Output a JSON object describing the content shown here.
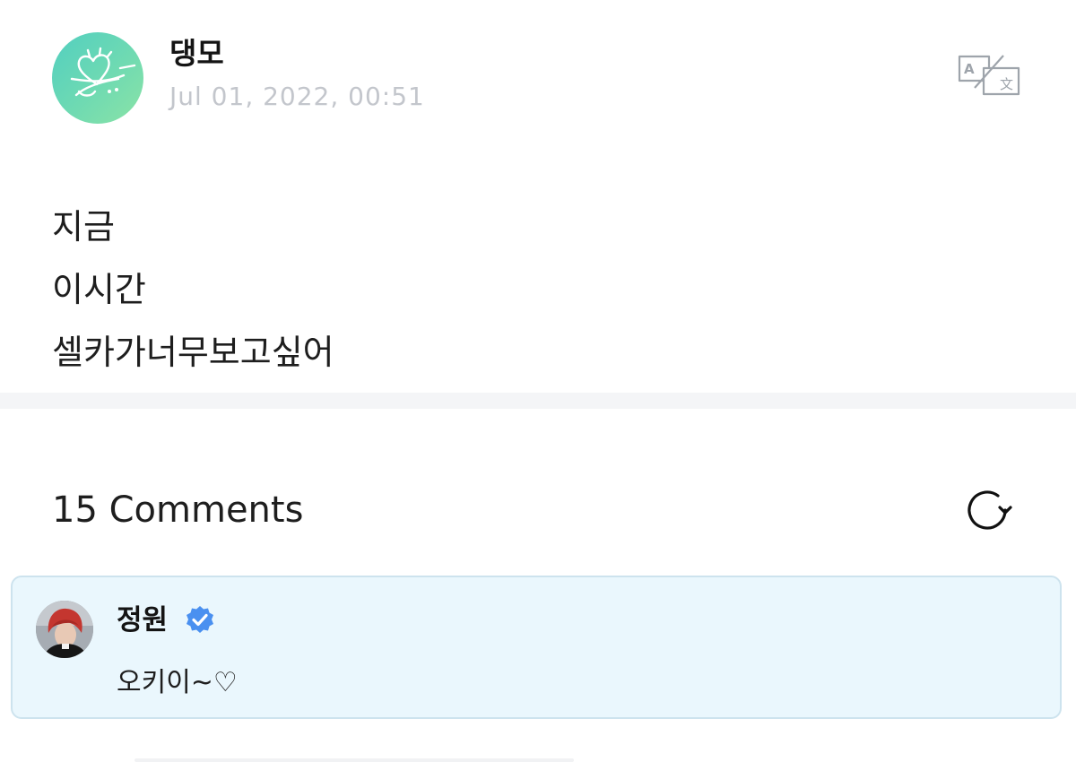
{
  "post": {
    "author": {
      "name": "댕모",
      "avatar_icon": "heart-doodle-avatar-icon"
    },
    "timestamp": "Jul 01, 2022, 00:51",
    "translate_icon": "translate-icon",
    "lines": [
      "지금",
      "이시간",
      "셀카가너무보고싶어"
    ]
  },
  "comments": {
    "count_label": "15 Comments",
    "refresh_icon": "refresh-icon",
    "items": [
      {
        "author": "정원",
        "verified": true,
        "verified_icon": "verified-badge-icon",
        "text": "오키이~♡"
      }
    ]
  },
  "colors": {
    "avatar_gradient_start": "#52cfc0",
    "avatar_gradient_end": "#8be3a6",
    "timestamp_gray": "#c3c6cc",
    "comment_bg": "#eaf7fd",
    "comment_border": "#cde3ee",
    "verified_blue": "#4a90f0",
    "divider_gray": "#f4f5f7"
  }
}
